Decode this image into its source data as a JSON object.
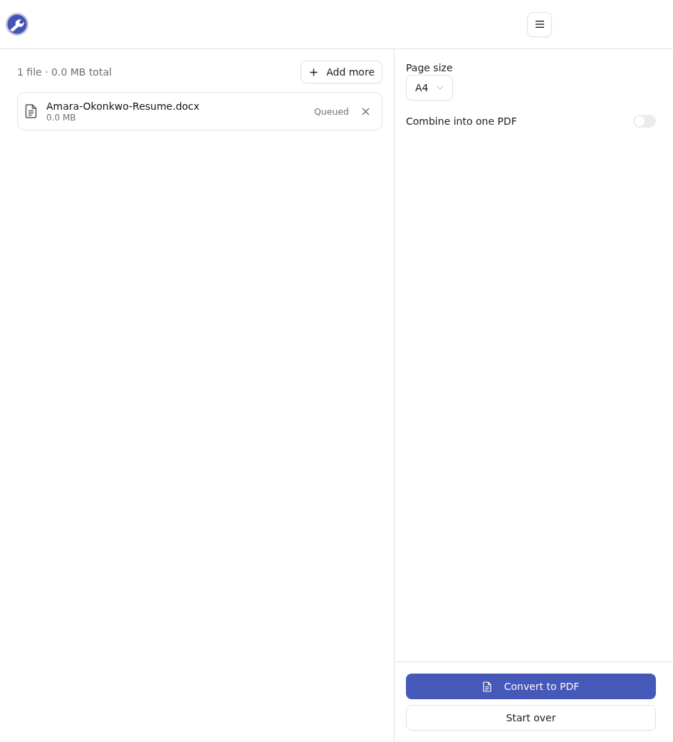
{
  "files_panel": {
    "summary": "1 file · 0.0 MB total",
    "add_button": {
      "label": "Add more"
    },
    "files": [
      {
        "name": "Amara-Okonkwo-Resume.docx",
        "size": "0.0 MB",
        "status": "Queued"
      }
    ]
  },
  "options": {
    "page_size": {
      "label": "Page size",
      "value": "A4"
    },
    "combine": {
      "label": "Combine into one PDF",
      "on": false
    }
  },
  "actions": [
    {
      "label": "Convert to PDF",
      "kind": "primary"
    },
    {
      "label": "Start over",
      "kind": "secondary"
    }
  ]
}
